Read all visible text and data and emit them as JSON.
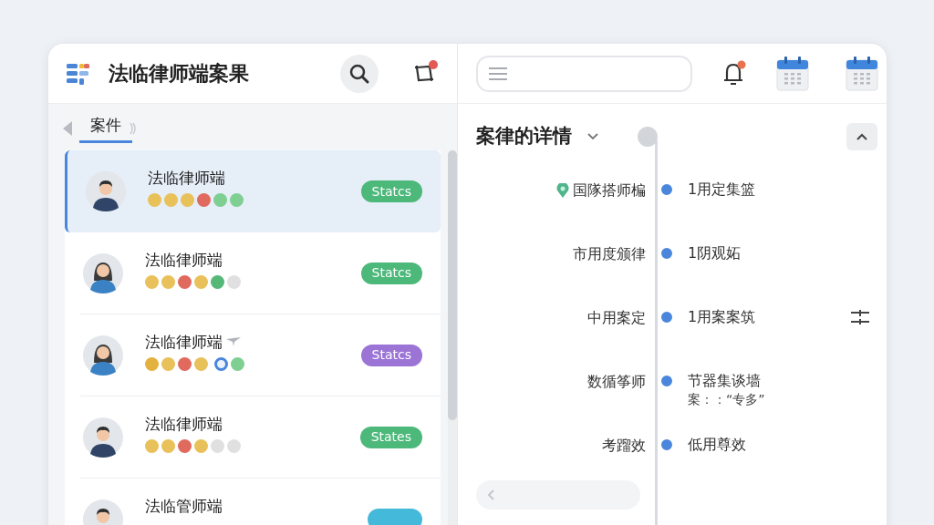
{
  "header": {
    "title": "法临律师端案果"
  },
  "tabs": [
    {
      "label": "案件",
      "selected": true
    }
  ],
  "cases": [
    {
      "name": "法临律师端",
      "kind": "man",
      "selected": true,
      "marked": false,
      "status": {
        "label": "Statcs",
        "color": "#4cb87a"
      },
      "dots": [
        {
          "color": "#e9c15a",
          "kind": "fill"
        },
        {
          "color": "#e9c15a",
          "kind": "fill"
        },
        {
          "color": "#e9c15a",
          "kind": "fill"
        },
        {
          "color": "#e06a5e",
          "kind": "fill"
        },
        {
          "color": "#7fcf92",
          "kind": "fill"
        },
        {
          "color": "#7fcf92",
          "kind": "fill"
        }
      ]
    },
    {
      "name": "法临律师端",
      "kind": "woman",
      "selected": false,
      "marked": false,
      "status": {
        "label": "Statcs",
        "color": "#4cb87a"
      },
      "dots": [
        {
          "color": "#e9c15a",
          "kind": "fill"
        },
        {
          "color": "#e9c15a",
          "kind": "fill"
        },
        {
          "color": "#e06a5e",
          "kind": "fill"
        },
        {
          "color": "#e9c15a",
          "kind": "fill"
        },
        {
          "color": "#55b876",
          "kind": "fill"
        },
        {
          "color": "#e0e0e0",
          "kind": "fill"
        }
      ]
    },
    {
      "name": "法临律师端",
      "kind": "woman",
      "selected": false,
      "marked": true,
      "status": {
        "label": "Statcs",
        "color": "#9b74d6"
      },
      "dots": [
        {
          "color": "#e3b23e",
          "kind": "fill"
        },
        {
          "color": "#e9c15a",
          "kind": "fill"
        },
        {
          "color": "#e06a5e",
          "kind": "fill"
        },
        {
          "color": "#e9c15a",
          "kind": "fill"
        },
        {
          "color": "#4a86db",
          "kind": "ring"
        },
        {
          "color": "#7fcf92",
          "kind": "fill"
        }
      ]
    },
    {
      "name": "法临律师端",
      "kind": "man",
      "selected": false,
      "marked": false,
      "status": {
        "label": "States",
        "color": "#4cb87a"
      },
      "dots": [
        {
          "color": "#e9c15a",
          "kind": "fill"
        },
        {
          "color": "#e9c15a",
          "kind": "fill"
        },
        {
          "color": "#e06a5e",
          "kind": "fill"
        },
        {
          "color": "#e9c15a",
          "kind": "fill"
        },
        {
          "color": "#e0e0e0",
          "kind": "fill"
        },
        {
          "color": "#e0e0e0",
          "kind": "fill"
        }
      ]
    },
    {
      "name": "法临管师端",
      "kind": "man",
      "selected": false,
      "marked": false,
      "status": {
        "color": "#45b9d9"
      }
    }
  ],
  "detail": {
    "title": "案律的详情",
    "timeline": [
      {
        "left": "国隊搭师楄",
        "right": "1用定集篮",
        "pinned": true
      },
      {
        "left": "市用度颁律",
        "right": "1阴观妬",
        "pinned": false
      },
      {
        "left": "中用案定",
        "right": "1用案案筑",
        "pinned": false
      },
      {
        "left": "数循筝师",
        "right": "节器集谈墙",
        "note": "案：：“专多”",
        "pinned": false
      },
      {
        "left": "考蹓效",
        "right": "低用尊效",
        "pinned": false
      }
    ]
  }
}
